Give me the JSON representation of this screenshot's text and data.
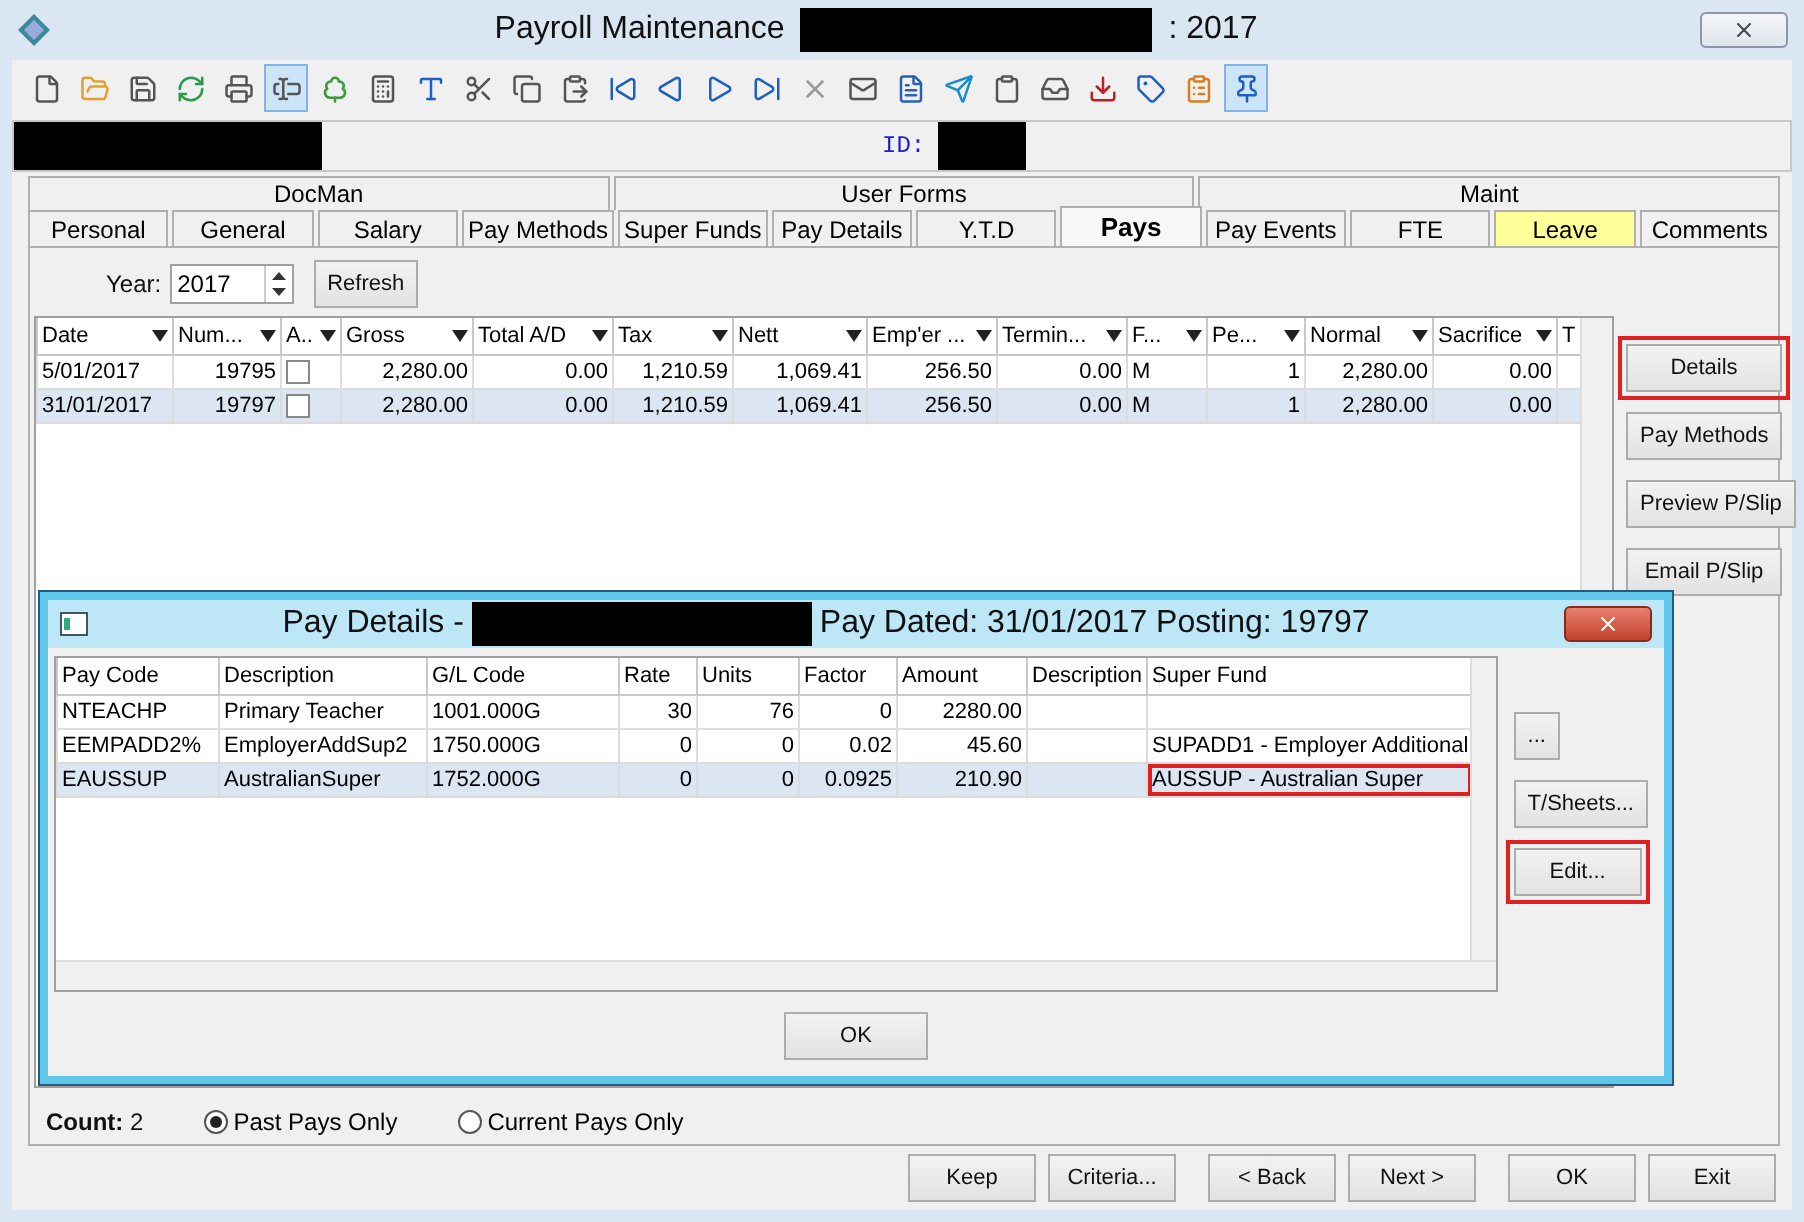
{
  "window": {
    "title": "Payroll Maintenance",
    "title_suffix": ": 2017"
  },
  "toolbar": [
    {
      "kind": "new",
      "selected": false
    },
    {
      "kind": "open",
      "selected": false
    },
    {
      "kind": "save",
      "selected": false
    },
    {
      "kind": "refresh",
      "selected": false
    },
    {
      "kind": "print",
      "selected": false
    },
    {
      "kind": "textbox",
      "selected": true
    },
    {
      "kind": "tree",
      "selected": false
    },
    {
      "kind": "calculator",
      "selected": false
    },
    {
      "kind": "spellcheck",
      "selected": false
    },
    {
      "kind": "cut",
      "selected": false
    },
    {
      "kind": "copy",
      "selected": false
    },
    {
      "kind": "paste",
      "selected": false
    },
    {
      "kind": "first",
      "selected": false
    },
    {
      "kind": "previous",
      "selected": false
    },
    {
      "kind": "next",
      "selected": false
    },
    {
      "kind": "last",
      "selected": false
    },
    {
      "kind": "delete",
      "selected": false
    },
    {
      "kind": "envelope",
      "selected": false
    },
    {
      "kind": "document",
      "selected": false
    },
    {
      "kind": "send",
      "selected": false
    },
    {
      "kind": "clipboard",
      "selected": false
    },
    {
      "kind": "approve",
      "selected": false
    },
    {
      "kind": "download",
      "selected": false
    },
    {
      "kind": "tag",
      "selected": false
    },
    {
      "kind": "checklist",
      "selected": false
    },
    {
      "kind": "pin",
      "selected": true
    }
  ],
  "id_label": "ID:",
  "tab_groups": [
    "DocMan",
    "User Forms",
    "Maint"
  ],
  "tabs": [
    {
      "label": "Personal",
      "selected": false
    },
    {
      "label": "General",
      "selected": false
    },
    {
      "label": "Salary",
      "selected": false
    },
    {
      "label": "Pay Methods",
      "selected": false
    },
    {
      "label": "Super Funds",
      "selected": false
    },
    {
      "label": "Pay Details",
      "selected": false
    },
    {
      "label": "Y.T.D",
      "selected": false
    },
    {
      "label": "Pays",
      "selected": true
    },
    {
      "label": "Pay Events",
      "selected": false
    },
    {
      "label": "FTE",
      "selected": false
    },
    {
      "label": "Leave",
      "selected": false,
      "color": "#ffff99"
    },
    {
      "label": "Comments",
      "selected": false
    }
  ],
  "year": {
    "label": "Year:",
    "value": "2017"
  },
  "refresh_button": "Refresh",
  "pays_table": {
    "columns": [
      "Date",
      "Num...",
      "A..",
      "Gross",
      "Total A/D",
      "Tax",
      "Nett",
      "Emp'er ...",
      "Termin...",
      "F...",
      "Pe...",
      "Normal",
      "Sacrifice",
      "T"
    ],
    "rows": [
      {
        "selected": false,
        "checked": false,
        "cells": [
          "5/01/2017",
          "19795",
          "",
          "2,280.00",
          "0.00",
          "1,210.59",
          "1,069.41",
          "256.50",
          "0.00",
          "M",
          "1",
          "2,280.00",
          "0.00",
          ""
        ]
      },
      {
        "selected": true,
        "checked": false,
        "cells": [
          "31/01/2017",
          "19797",
          "",
          "2,280.00",
          "0.00",
          "1,210.59",
          "1,069.41",
          "256.50",
          "0.00",
          "M",
          "1",
          "2,280.00",
          "0.00",
          ""
        ]
      }
    ]
  },
  "side_buttons": [
    {
      "label": "Details",
      "highlighted": true
    },
    {
      "label": "Pay Methods",
      "highlighted": false
    },
    {
      "label": "Preview P/Slip",
      "highlighted": false
    },
    {
      "label": "Email P/Slip",
      "highlighted": false
    }
  ],
  "dialog": {
    "title": "Pay Details -",
    "title_suffix": "Pay Dated: 31/01/2017  Posting: 19797",
    "columns": [
      "Pay Code",
      "Description",
      "G/L Code",
      "Rate",
      "Units",
      "Factor",
      "Amount",
      "Description",
      "Super Fund"
    ],
    "rows": [
      {
        "selected": false,
        "cells": [
          "NTEACHP",
          "Primary Teacher",
          "1001.000G",
          "30",
          "76",
          "0",
          "2280.00",
          "",
          ""
        ],
        "highlighted_cell": false
      },
      {
        "selected": false,
        "cells": [
          "EEMPADD2%",
          "EmployerAddSup2",
          "1750.000G",
          "0",
          "0",
          "0.02",
          "45.60",
          "",
          "SUPADD1 - Employer Additional"
        ],
        "highlighted_cell": false
      },
      {
        "selected": true,
        "cells": [
          "EAUSSUP",
          "AustralianSuper",
          "1752.000G",
          "0",
          "0",
          "0.0925",
          "210.90",
          "",
          "AUSSUP - Australian Super"
        ],
        "highlighted_cell": true
      }
    ],
    "side_buttons": [
      {
        "label": "...",
        "highlighted": false
      },
      {
        "label": "T/Sheets...",
        "highlighted": false
      },
      {
        "label": "Edit...",
        "highlighted": true
      }
    ],
    "ok_button": "OK"
  },
  "count": {
    "label": "Count:",
    "value": "2"
  },
  "filters": [
    {
      "label": "Past Pays Only",
      "selected": true
    },
    {
      "label": "Current Pays Only",
      "selected": false
    }
  ],
  "bottom_buttons": [
    "Keep",
    "Criteria...",
    "< Back",
    "Next >",
    "OK",
    "Exit"
  ]
}
